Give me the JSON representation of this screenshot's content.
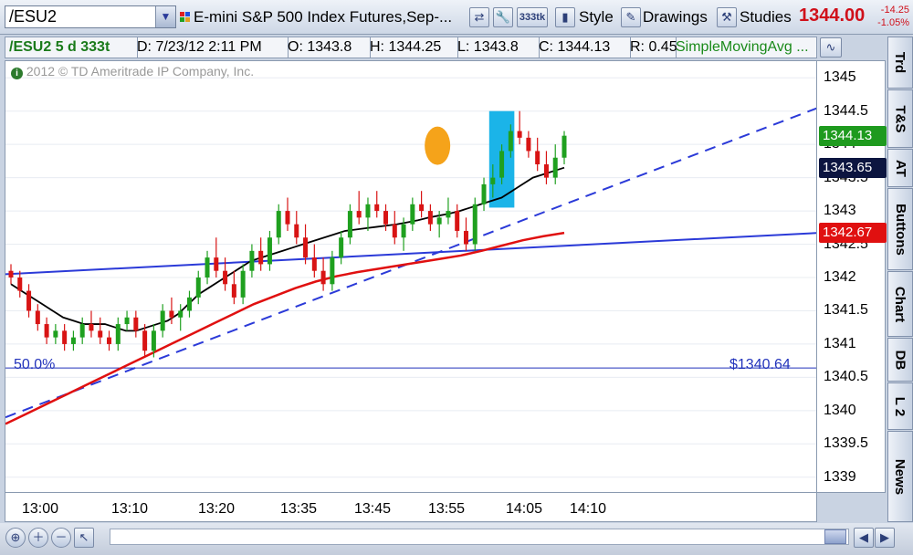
{
  "toolbar": {
    "symbol": "/ESU2",
    "description": "E-mini S&P 500 Index Futures,Sep-...",
    "tick_badge": "333tk",
    "style_label": "Style",
    "drawings_label": "Drawings",
    "studies_label": "Studies",
    "last_price": "1344.00",
    "change": "-14.25",
    "change_pct": "-1.05%"
  },
  "infobar": {
    "symbol_period": "/ESU2 5 d 333t",
    "date": "D: 7/23/12 2:11 PM",
    "open": "O: 1343.8",
    "high": "H: 1344.25",
    "low": "L: 1343.8",
    "close": "C: 1344.13",
    "range": "R: 0.45",
    "study": "SimpleMovingAvg ..."
  },
  "chart": {
    "copyright": "2012 © TD Ameritrade IP Company, Inc.",
    "fib_label": "50.0%",
    "fib_price": "$1340.64",
    "y_ticks": [
      "1345",
      "1344.5",
      "1344",
      "1343.5",
      "1343",
      "1342.5",
      "1342",
      "1341.5",
      "1341",
      "1340.5",
      "1340",
      "1339.5",
      "1339"
    ],
    "x_ticks": [
      "13:00",
      "13:10",
      "13:20",
      "13:35",
      "13:45",
      "13:55",
      "14:05",
      "14:10"
    ],
    "price_labels": [
      {
        "value": "1344.13",
        "color": "#1e9a1e"
      },
      {
        "value": "1343.65",
        "color": "#0c1540"
      },
      {
        "value": "1342.67",
        "color": "#e01010"
      }
    ]
  },
  "side_tabs": [
    "Trd",
    "T&S",
    "AT",
    "Buttons",
    "Chart",
    "DB",
    "L 2",
    "News"
  ],
  "colors": {
    "up_candle": "#1fa01f",
    "down_candle": "#d81414",
    "sma_fast": "#000000",
    "sma_slow": "#e01010",
    "trendline": "#2b3ad8",
    "highlight": "#1bb4e8",
    "marker": "#f5a31a"
  },
  "chart_data": {
    "type": "candlestick",
    "ylim": [
      1339,
      1345.2
    ],
    "candles": [
      [
        1342.1,
        1342.2,
        1341.9,
        1342.0
      ],
      [
        1342.0,
        1342.1,
        1341.7,
        1341.8
      ],
      [
        1341.8,
        1341.9,
        1341.4,
        1341.5
      ],
      [
        1341.5,
        1341.6,
        1341.2,
        1341.3
      ],
      [
        1341.3,
        1341.4,
        1341.0,
        1341.1
      ],
      [
        1341.1,
        1341.3,
        1341.0,
        1341.2
      ],
      [
        1341.2,
        1341.3,
        1340.9,
        1341.0
      ],
      [
        1341.0,
        1341.2,
        1340.9,
        1341.1
      ],
      [
        1341.1,
        1341.4,
        1341.0,
        1341.3
      ],
      [
        1341.3,
        1341.5,
        1341.1,
        1341.2
      ],
      [
        1341.2,
        1341.4,
        1341.0,
        1341.1
      ],
      [
        1341.1,
        1341.2,
        1340.9,
        1341.0
      ],
      [
        1341.0,
        1341.4,
        1340.9,
        1341.3
      ],
      [
        1341.3,
        1341.5,
        1341.2,
        1341.4
      ],
      [
        1341.4,
        1341.5,
        1341.1,
        1341.2
      ],
      [
        1341.2,
        1341.3,
        1340.8,
        1340.9
      ],
      [
        1340.9,
        1341.3,
        1340.8,
        1341.2
      ],
      [
        1341.2,
        1341.6,
        1341.1,
        1341.5
      ],
      [
        1341.5,
        1341.7,
        1341.3,
        1341.4
      ],
      [
        1341.4,
        1341.6,
        1341.2,
        1341.5
      ],
      [
        1341.5,
        1341.8,
        1341.4,
        1341.7
      ],
      [
        1341.7,
        1342.1,
        1341.6,
        1342.0
      ],
      [
        1342.0,
        1342.4,
        1341.9,
        1342.3
      ],
      [
        1342.3,
        1342.6,
        1342.0,
        1342.1
      ],
      [
        1342.1,
        1342.3,
        1341.8,
        1341.9
      ],
      [
        1341.9,
        1342.1,
        1341.6,
        1341.7
      ],
      [
        1341.7,
        1342.2,
        1341.6,
        1342.1
      ],
      [
        1342.1,
        1342.5,
        1342.0,
        1342.4
      ],
      [
        1342.4,
        1342.6,
        1342.1,
        1342.2
      ],
      [
        1342.2,
        1342.7,
        1342.1,
        1342.6
      ],
      [
        1342.6,
        1343.1,
        1342.5,
        1343.0
      ],
      [
        1343.0,
        1343.2,
        1342.7,
        1342.8
      ],
      [
        1342.8,
        1343.0,
        1342.5,
        1342.6
      ],
      [
        1342.6,
        1342.8,
        1342.2,
        1342.3
      ],
      [
        1342.3,
        1342.5,
        1342.0,
        1342.1
      ],
      [
        1342.1,
        1342.3,
        1341.8,
        1341.9
      ],
      [
        1341.9,
        1342.4,
        1341.8,
        1342.3
      ],
      [
        1342.3,
        1342.7,
        1342.2,
        1342.6
      ],
      [
        1342.6,
        1343.1,
        1342.5,
        1343.0
      ],
      [
        1343.0,
        1343.3,
        1342.8,
        1342.9
      ],
      [
        1342.9,
        1343.2,
        1342.7,
        1343.1
      ],
      [
        1343.1,
        1343.3,
        1342.9,
        1343.0
      ],
      [
        1343.0,
        1343.1,
        1342.7,
        1342.8
      ],
      [
        1342.8,
        1343.0,
        1342.5,
        1342.6
      ],
      [
        1342.6,
        1342.9,
        1342.4,
        1342.8
      ],
      [
        1342.8,
        1343.2,
        1342.7,
        1343.1
      ],
      [
        1343.1,
        1343.3,
        1342.9,
        1343.0
      ],
      [
        1343.0,
        1343.1,
        1342.7,
        1342.8
      ],
      [
        1342.8,
        1343.0,
        1342.6,
        1342.9
      ],
      [
        1342.9,
        1343.2,
        1342.8,
        1343.0
      ],
      [
        1343.0,
        1343.1,
        1342.6,
        1342.7
      ],
      [
        1342.7,
        1342.9,
        1342.4,
        1342.5
      ],
      [
        1342.5,
        1343.2,
        1342.4,
        1343.1
      ],
      [
        1343.1,
        1343.5,
        1343.0,
        1343.4
      ],
      [
        1343.4,
        1343.7,
        1343.2,
        1343.5
      ],
      [
        1343.5,
        1344.0,
        1343.4,
        1343.9
      ],
      [
        1343.9,
        1344.3,
        1343.8,
        1344.2
      ],
      [
        1344.2,
        1344.5,
        1344.0,
        1344.1
      ],
      [
        1344.1,
        1344.2,
        1343.8,
        1343.9
      ],
      [
        1343.9,
        1344.1,
        1343.6,
        1343.7
      ],
      [
        1343.7,
        1343.9,
        1343.4,
        1343.5
      ],
      [
        1343.5,
        1344.0,
        1343.4,
        1343.8
      ],
      [
        1343.8,
        1344.2,
        1343.7,
        1344.13
      ]
    ],
    "sma_fast": [
      1341.9,
      1341.8,
      1341.7,
      1341.6,
      1341.5,
      1341.4,
      1341.35,
      1341.3,
      1341.3,
      1341.3,
      1341.25,
      1341.2,
      1341.2,
      1341.25,
      1341.3,
      1341.35,
      1341.45,
      1341.6,
      1341.75,
      1341.85,
      1341.95,
      1342.05,
      1342.15,
      1342.25,
      1342.3,
      1342.35,
      1342.4,
      1342.45,
      1342.5,
      1342.55,
      1342.6,
      1342.65,
      1342.7,
      1342.72,
      1342.74,
      1342.76,
      1342.78,
      1342.8,
      1342.83,
      1342.86,
      1342.9,
      1342.93,
      1342.96,
      1343.0,
      1343.05,
      1343.1,
      1343.15,
      1343.2,
      1343.3,
      1343.4,
      1343.5,
      1343.55,
      1343.6,
      1343.65
    ],
    "sma_slow": [
      1339.8,
      1339.95,
      1340.1,
      1340.25,
      1340.4,
      1340.55,
      1340.7,
      1340.85,
      1341.0,
      1341.15,
      1341.3,
      1341.45,
      1341.6,
      1341.72,
      1341.84,
      1341.94,
      1342.02,
      1342.08,
      1342.13,
      1342.18,
      1342.23,
      1342.28,
      1342.33,
      1342.4,
      1342.48,
      1342.56,
      1342.62,
      1342.67
    ],
    "trendlines": [
      {
        "style": "solid",
        "from": [
          0,
          1342.05
        ],
        "to": [
          1,
          1342.67
        ]
      },
      {
        "style": "dashed",
        "from": [
          0,
          1339.9
        ],
        "to": [
          1,
          1344.55
        ]
      }
    ],
    "fib_level": {
      "pct": "50.0%",
      "price": 1340.64
    },
    "highlight_bars": [
      54,
      56
    ],
    "x_ticks": [
      "13:00",
      "13:10",
      "13:20",
      "13:35",
      "13:45",
      "13:55",
      "14:05",
      "14:10"
    ]
  }
}
